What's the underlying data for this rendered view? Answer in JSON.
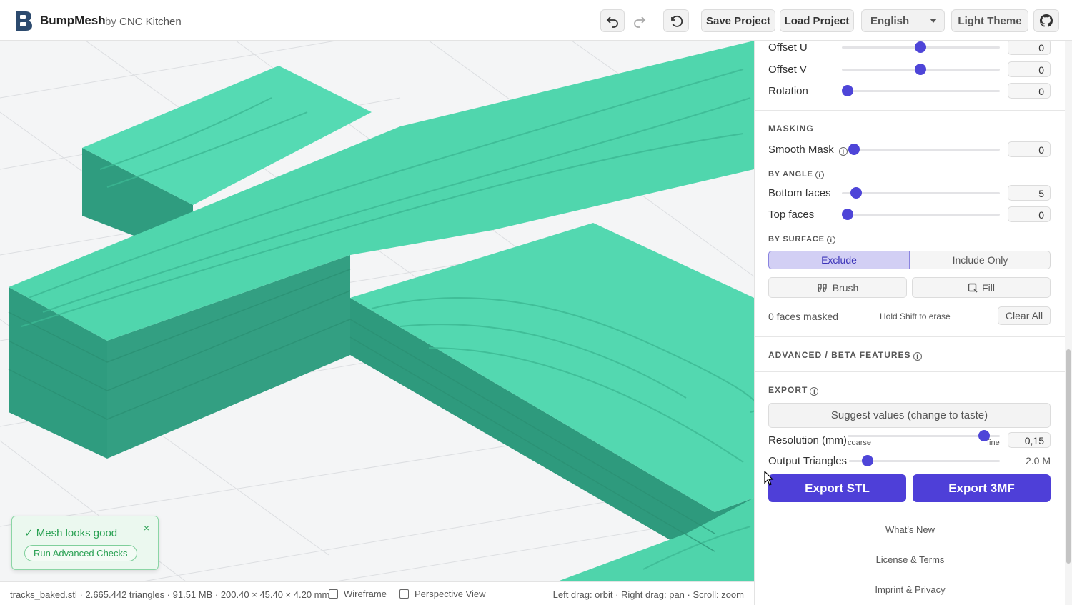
{
  "header": {
    "brand": "BumpMesh",
    "by": "by",
    "author": "CNC Kitchen",
    "save_label": "Save Project",
    "load_label": "Load Project",
    "language": "English",
    "theme_label": "Light Theme"
  },
  "viewport": {
    "toast_message": "✓ Mesh looks good",
    "toast_close": "×",
    "toast_action": "Run Advanced Checks"
  },
  "status": {
    "file_info": "tracks_baked.stl · 2.665.442 triangles · 91.51 MB · 200.40 × 45.40 × 4.20 mm",
    "wireframe_label": "Wireframe",
    "perspective_label": "Perspective View",
    "hints": "Left drag: orbit · Right drag: pan · Scroll: zoom"
  },
  "transform": {
    "offset_u": {
      "label": "Offset U",
      "value": "0",
      "level": 0.5
    },
    "offset_v": {
      "label": "Offset V",
      "value": "0",
      "level": 0.5
    },
    "rotation": {
      "label": "Rotation",
      "value": "0",
      "level": 0
    }
  },
  "masking": {
    "title": "MASKING",
    "smooth_mask": {
      "label": "Smooth Mask",
      "value": "0",
      "level": 0
    },
    "by_angle_title": "BY ANGLE",
    "bottom_faces": {
      "label": "Bottom faces",
      "value": "5",
      "level": 0.05
    },
    "top_faces": {
      "label": "Top faces",
      "value": "0",
      "level": 0
    },
    "by_surface_title": "BY SURFACE",
    "exclude_label": "Exclude",
    "include_label": "Include Only",
    "brush_label": "Brush",
    "fill_label": "Fill",
    "faces_masked": "0 faces masked",
    "erase_hint": "Hold Shift to erase",
    "clear_label": "Clear All"
  },
  "advanced": {
    "title": "ADVANCED / BETA FEATURES"
  },
  "export": {
    "title": "EXPORT",
    "suggest_label": "Suggest values (change to taste)",
    "resolution": {
      "label": "Resolution (mm)",
      "value": "0,15",
      "coarse": "coarse",
      "fine": "fine",
      "level": 0.9
    },
    "triangles": {
      "label": "Output Triangles",
      "value": "2.0 M",
      "level": 0.13
    },
    "stl_label": "Export STL",
    "threemf_label": "Export 3MF"
  },
  "footer_links": {
    "whats_new": "What's New",
    "license": "License & Terms",
    "imprint": "Imprint & Privacy"
  },
  "colors": {
    "accent": "#4e3fd8",
    "mesh": "#4fd6ad",
    "toast_green": "#2aa153"
  }
}
